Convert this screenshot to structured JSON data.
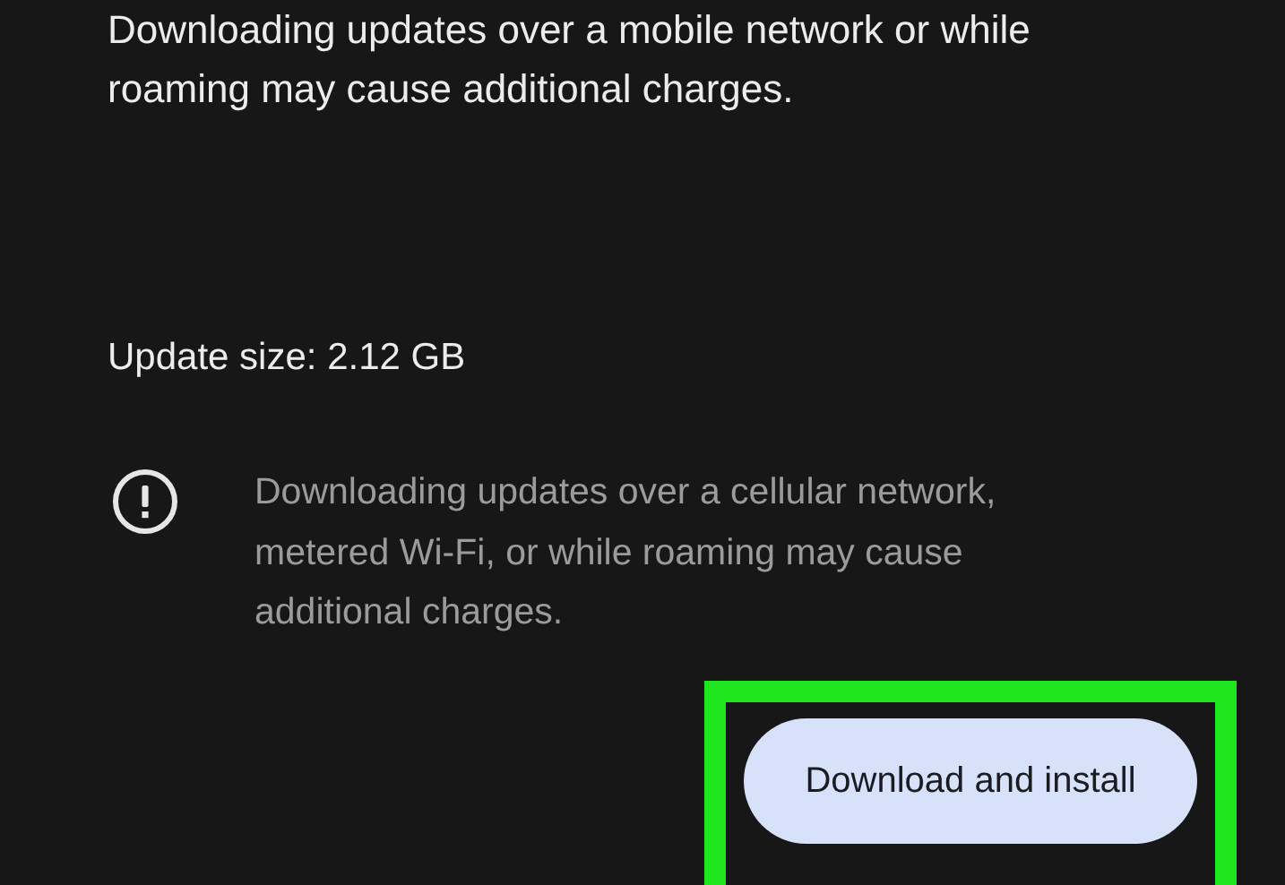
{
  "notice": "Downloading updates over a mobile network or while roaming may cause additional charges.",
  "update_size": "Update size: 2.12 GB",
  "warning": "Downloading updates over a cellular network, metered Wi-Fi, or while roaming may cause additional charges.",
  "button": {
    "label": "Download and install",
    "highlighted": true
  }
}
